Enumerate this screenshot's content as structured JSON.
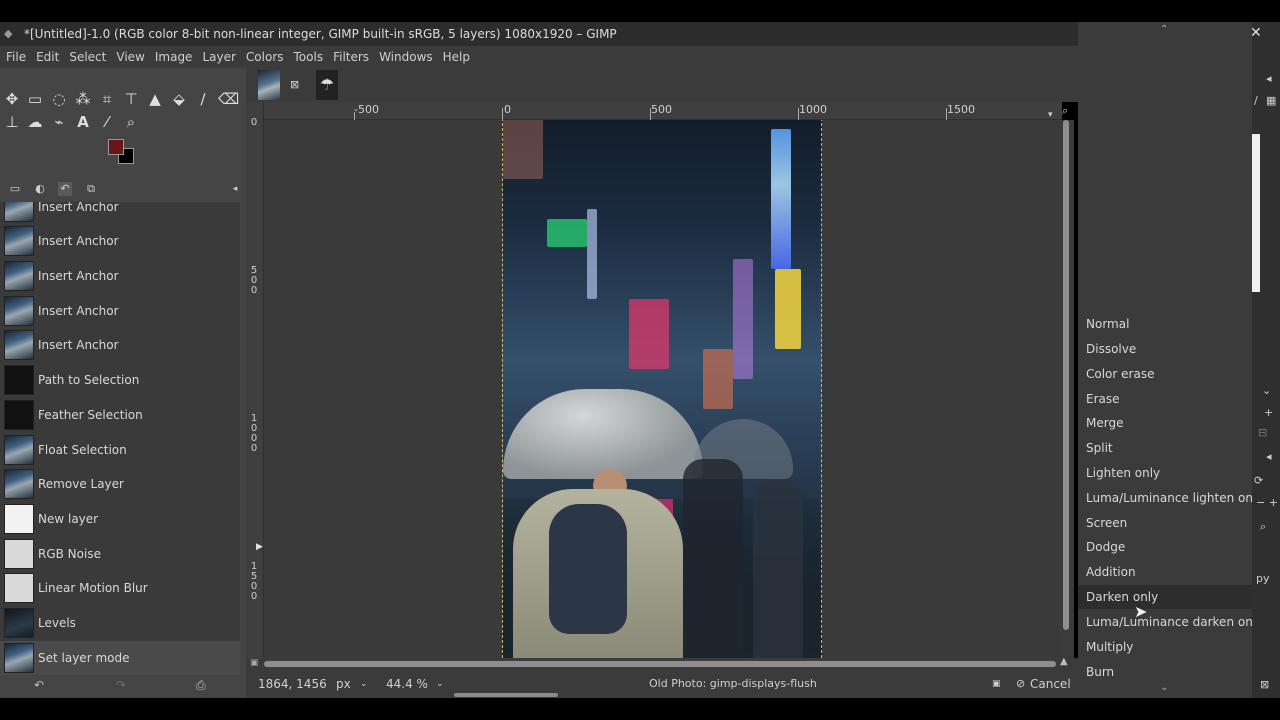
{
  "window": {
    "title": "*[Untitled]-1.0 (RGB color 8-bit non-linear integer, GIMP built-in sRGB, 5 layers) 1080x1920 – GIMP",
    "close_glyph": "✕"
  },
  "menu": [
    "File",
    "Edit",
    "Select",
    "View",
    "Image",
    "Layer",
    "Colors",
    "Tools",
    "Filters",
    "Windows",
    "Help"
  ],
  "tools": {
    "row1": [
      "move-tool-icon",
      "rect-select-icon",
      "lasso-icon",
      "fuzzy-select-icon",
      "crop-icon",
      "transform-icon",
      "warp-icon",
      "bucket-fill-icon",
      "paintbrush-icon",
      "eraser-icon"
    ],
    "row2": [
      "clone-icon",
      "smudge-icon",
      "paths-icon",
      "text-icon",
      "color-picker-icon",
      "zoom-icon"
    ],
    "fg_color": "#6a1616",
    "bg_color": "#000000"
  },
  "history": {
    "items": [
      {
        "label": "Insert Anchor",
        "thumb": "photo"
      },
      {
        "label": "Insert Anchor",
        "thumb": "photo"
      },
      {
        "label": "Insert Anchor",
        "thumb": "photo"
      },
      {
        "label": "Insert Anchor",
        "thumb": "photo"
      },
      {
        "label": "Insert Anchor",
        "thumb": "photo"
      },
      {
        "label": "Path to Selection",
        "thumb": "black"
      },
      {
        "label": "Feather Selection",
        "thumb": "black"
      },
      {
        "label": "Float Selection",
        "thumb": "photo"
      },
      {
        "label": "Remove Layer",
        "thumb": "photo"
      },
      {
        "label": "New layer",
        "thumb": "white"
      },
      {
        "label": "RGB Noise",
        "thumb": "noise"
      },
      {
        "label": "Linear Motion Blur",
        "thumb": "noise"
      },
      {
        "label": "Levels",
        "thumb": "dark"
      },
      {
        "label": "Set layer mode",
        "thumb": "photo"
      }
    ],
    "selected_index": 13
  },
  "rulers": {
    "h_labels": [
      "-500",
      "0",
      "500",
      "1000",
      "1500"
    ],
    "v_labels": [
      "0",
      "500",
      "1000",
      "1500"
    ]
  },
  "status": {
    "coords": "1864, 1456",
    "unit": "px",
    "zoom": "44.4 %",
    "message": "Old Photo: gimp-displays-flush",
    "cancel": "Cancel"
  },
  "layer_modes": {
    "items": [
      "Normal",
      "Dissolve",
      "Color erase",
      "Erase",
      "Merge",
      "Split",
      "Lighten only",
      "Luma/Luminance lighten only",
      "Screen",
      "Dodge",
      "Addition",
      "Darken only",
      "Luma/Luminance darken only",
      "Multiply",
      "Burn"
    ],
    "highlighted": "Darken only"
  },
  "right_edge": {
    "partial_text": "py"
  }
}
